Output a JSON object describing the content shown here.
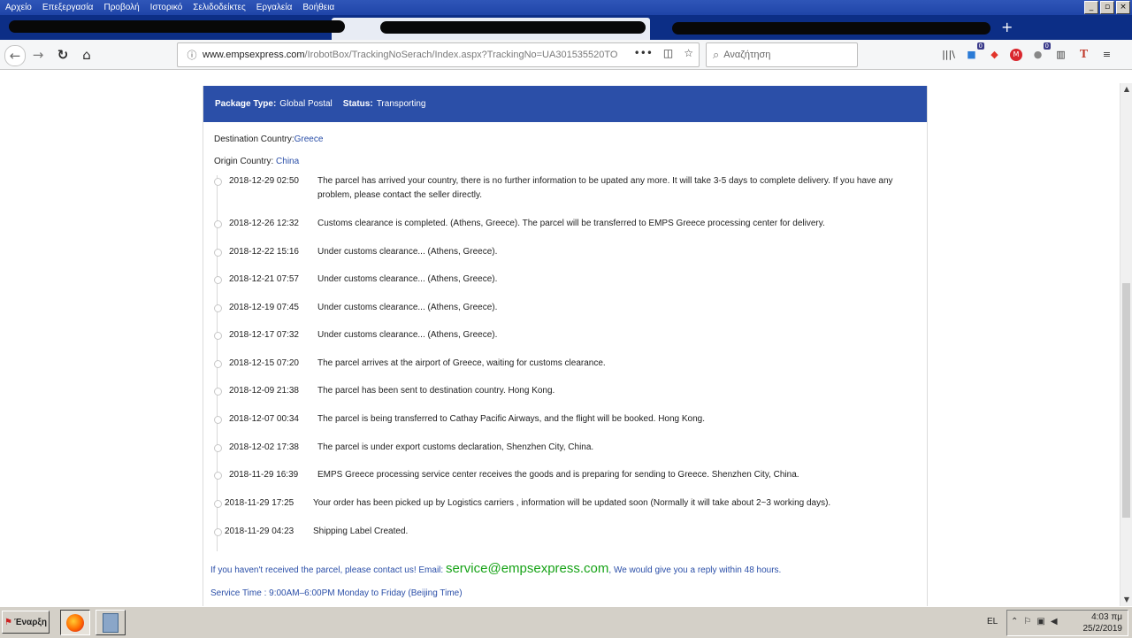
{
  "menu": [
    "Αρχείο",
    "Επεξεργασία",
    "Προβολή",
    "Ιστορικό",
    "Σελιδοδείκτες",
    "Εργαλεία",
    "Βοήθεια"
  ],
  "window_controls": {
    "minimize": "_",
    "maximize": "▫",
    "close": "×"
  },
  "url": {
    "host": "www.empsexpress.com",
    "path": "/IrobotBox/TrackingNoSerach/Index.aspx?TrackingNo=UA301535520TO"
  },
  "search": {
    "placeholder": "Αναζήτηση"
  },
  "toolbar_badges": {
    "notifications": "0",
    "extensions": "0"
  },
  "header": {
    "package_type_label": "Package Type:",
    "package_type_value": "Global Postal",
    "status_label": "Status:",
    "status_value": "Transporting"
  },
  "destination": {
    "label": "Destination Country:",
    "value": "Greece"
  },
  "origin": {
    "label": "Origin Country:",
    "value": "China"
  },
  "events": [
    {
      "time": "2018-12-29 02:50",
      "desc": "The parcel has arrived your country, there is no further information to be upated any more. It will take 3-5 days to complete delivery. If you have any problem, please contact the seller directly."
    },
    {
      "time": "2018-12-26 12:32",
      "desc": "Customs clearance is completed. (Athens, Greece). The parcel will be transferred to EMPS Greece processing center for delivery."
    },
    {
      "time": "2018-12-22 15:16",
      "desc": "Under customs clearance... (Athens, Greece)."
    },
    {
      "time": "2018-12-21 07:57",
      "desc": "Under customs clearance... (Athens, Greece)."
    },
    {
      "time": "2018-12-19 07:45",
      "desc": "Under customs clearance... (Athens, Greece)."
    },
    {
      "time": "2018-12-17 07:32",
      "desc": "Under customs clearance... (Athens, Greece)."
    },
    {
      "time": "2018-12-15 07:20",
      "desc": "The parcel arrives at the airport of Greece, waiting for customs clearance."
    },
    {
      "time": "2018-12-09 21:38",
      "desc": "The parcel has been sent to destination country. Hong Kong."
    },
    {
      "time": "2018-12-07 00:34",
      "desc": "The parcel is being transferred to Cathay Pacific Airways, and the flight will be booked. Hong Kong."
    },
    {
      "time": "2018-12-02 17:38",
      "desc": "The parcel is under export customs declaration, Shenzhen City, China."
    },
    {
      "time": "2018-11-29 16:39",
      "desc": "EMPS Greece processing service center receives the goods and is preparing for sending to Greece. Shenzhen City, China."
    },
    {
      "time": "2018-11-29 17:25",
      "desc": "Your order has been picked up by Logistics carriers , information will be updated soon (Normally it will take about 2~3 working days)."
    },
    {
      "time": "2018-11-29 04:23",
      "desc": "Shipping Label Created."
    }
  ],
  "contact": {
    "prefix": "If you haven't received the parcel, please contact us! Email:",
    "email": "service@empsexpress.com",
    "suffix": ", We would give you a reply within 48 hours."
  },
  "service_time": "Service Time :  9:00AM–6:00PM Monday to Friday (Beijing Time)",
  "taskbar": {
    "start_label": "Έναρξη",
    "language": "EL",
    "time": "4:03 πμ",
    "date": "25/2/2019"
  }
}
